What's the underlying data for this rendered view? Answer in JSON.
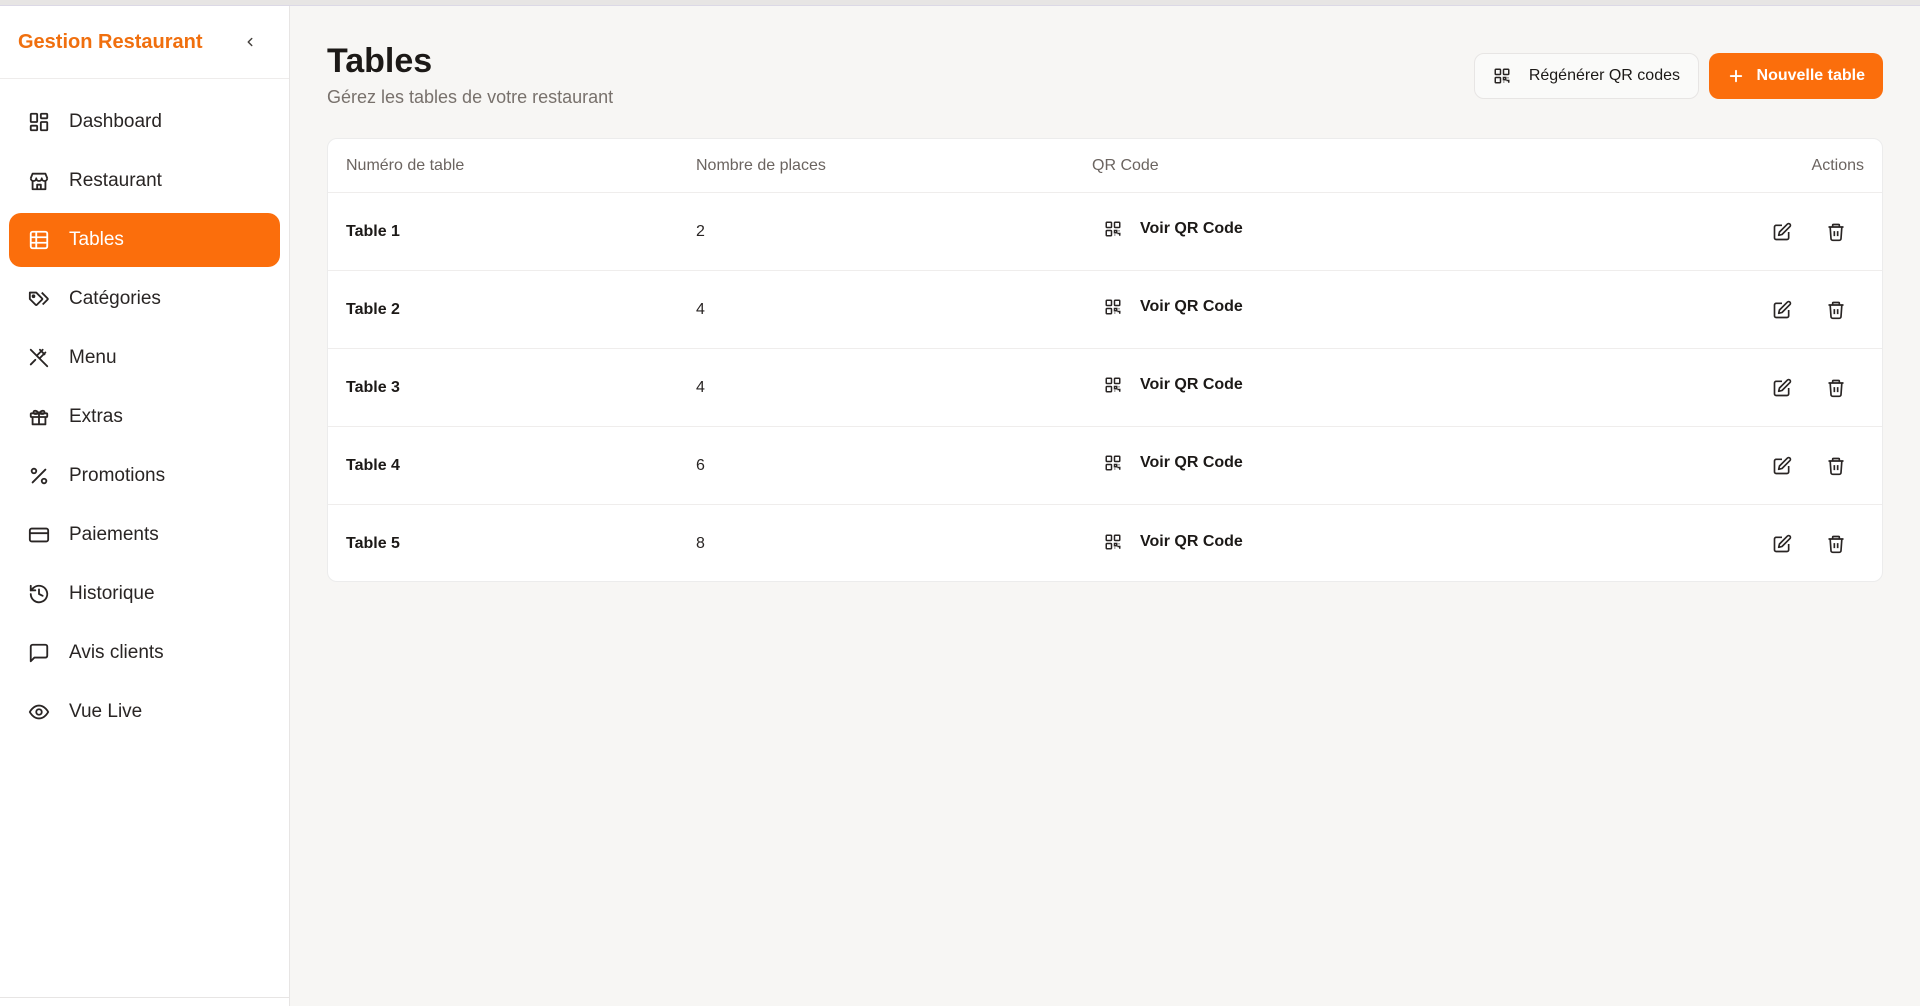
{
  "app": {
    "title": "Gestion Restaurant"
  },
  "sidebar": {
    "items": [
      {
        "label": "Dashboard",
        "icon": "dashboard-icon",
        "active": false
      },
      {
        "label": "Restaurant",
        "icon": "store-icon",
        "active": false
      },
      {
        "label": "Tables",
        "icon": "table-icon",
        "active": true
      },
      {
        "label": "Catégories",
        "icon": "tags-icon",
        "active": false
      },
      {
        "label": "Menu",
        "icon": "utensils-icon",
        "active": false
      },
      {
        "label": "Extras",
        "icon": "gift-icon",
        "active": false
      },
      {
        "label": "Promotions",
        "icon": "percent-icon",
        "active": false
      },
      {
        "label": "Paiements",
        "icon": "credit-card-icon",
        "active": false
      },
      {
        "label": "Historique",
        "icon": "history-icon",
        "active": false
      },
      {
        "label": "Avis clients",
        "icon": "message-icon",
        "active": false
      },
      {
        "label": "Vue Live",
        "icon": "eye-icon",
        "active": false
      }
    ]
  },
  "page": {
    "title": "Tables",
    "subtitle": "Gérez les tables de votre restaurant",
    "regen_label": "Régénérer QR codes",
    "new_label": "Nouvelle table"
  },
  "table": {
    "headers": [
      "Numéro de table",
      "Nombre de places",
      "QR Code",
      "Actions"
    ],
    "rows": [
      {
        "name": "Table 1",
        "seats": "2",
        "qr": "Voir QR Code"
      },
      {
        "name": "Table 2",
        "seats": "4",
        "qr": "Voir QR Code"
      },
      {
        "name": "Table 3",
        "seats": "4",
        "qr": "Voir QR Code"
      },
      {
        "name": "Table 4",
        "seats": "6",
        "qr": "Voir QR Code"
      },
      {
        "name": "Table 5",
        "seats": "8",
        "qr": "Voir QR Code"
      }
    ]
  },
  "colors": {
    "accent": "#fb6e0c",
    "brand": "#f06f0e"
  }
}
